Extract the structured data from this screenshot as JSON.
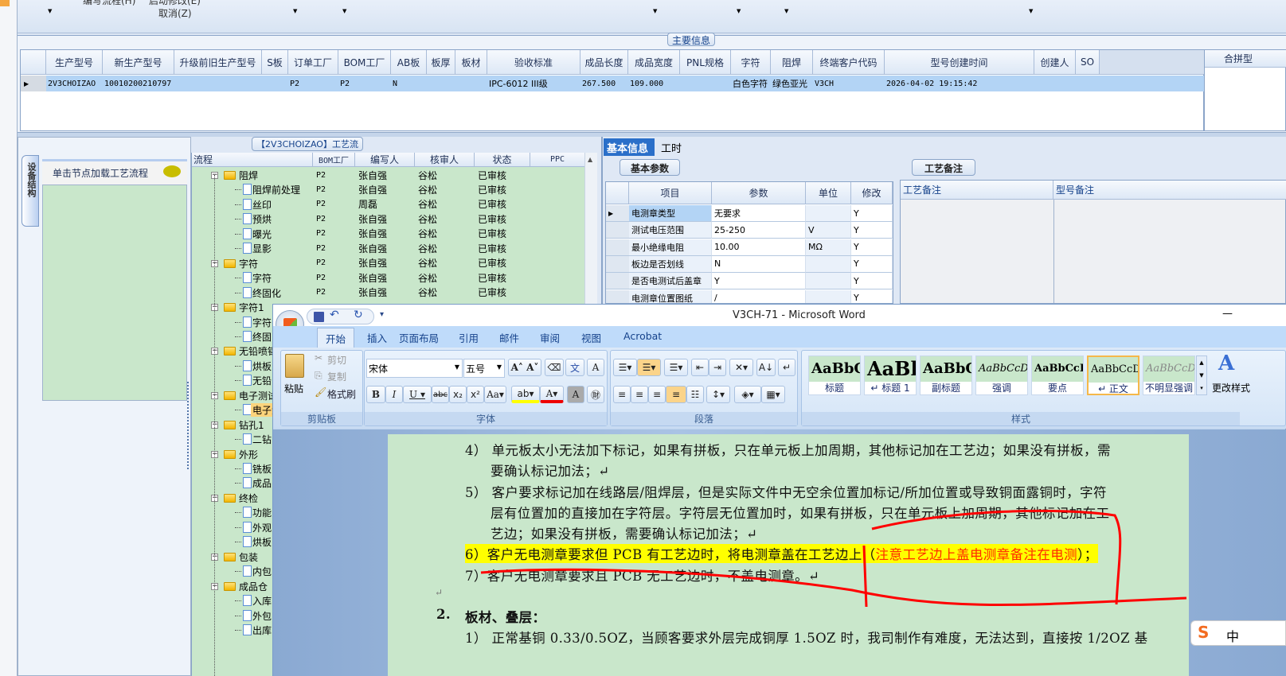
{
  "toolbar": {
    "edit_flow": "编写流程(H)",
    "start_modify": "启动修改(E)",
    "cancel": "取消(Z)"
  },
  "main_info": {
    "group_title": "主要信息",
    "right_header": "合拼型",
    "columns": [
      "生产型号",
      "新生产型号",
      "升级前旧生产型号",
      "S板",
      "订单工厂",
      "BOM工厂",
      "AB板",
      "板厚",
      "板材",
      "验收标准",
      "成品长度",
      "成品宽度",
      "PNL规格",
      "字符",
      "阻焊",
      "终端客户代码",
      "型号创建时间",
      "创建人",
      "SO"
    ],
    "row": [
      "2V3CHOIZAO",
      "10010200210797",
      "",
      "",
      "P2",
      "P2",
      "N",
      "",
      "",
      "IPC-6012 III级",
      "267.500",
      "109.000",
      "",
      "白色字符",
      "绿色亚光",
      "V3CH",
      "2026-04-02 19:15:42",
      "",
      ""
    ]
  },
  "left_panel": {
    "vertical_tab": "设备结构",
    "hint": "单击节点加载工艺流程"
  },
  "process": {
    "title": "【2V3CHOIZAO】工艺流程",
    "columns": [
      "流程",
      "BOM工厂",
      "编写人",
      "核审人",
      "状态",
      "PPC"
    ],
    "rows": [
      {
        "level": 0,
        "name": "阻焊",
        "cols": [
          "P2",
          "张自强",
          "谷松",
          "已审核",
          ""
        ]
      },
      {
        "level": 1,
        "name": "阻焊前处理",
        "cols": [
          "P2",
          "张自强",
          "谷松",
          "已审核",
          ""
        ]
      },
      {
        "level": 1,
        "name": "丝印",
        "cols": [
          "P2",
          "周磊",
          "谷松",
          "已审核",
          ""
        ]
      },
      {
        "level": 1,
        "name": "预烘",
        "cols": [
          "P2",
          "张自强",
          "谷松",
          "已审核",
          ""
        ]
      },
      {
        "level": 1,
        "name": "曝光",
        "cols": [
          "P2",
          "张自强",
          "谷松",
          "已审核",
          ""
        ]
      },
      {
        "level": 1,
        "name": "显影",
        "cols": [
          "P2",
          "张自强",
          "谷松",
          "已审核",
          ""
        ]
      },
      {
        "level": 0,
        "name": "字符",
        "cols": [
          "P2",
          "张自强",
          "谷松",
          "已审核",
          ""
        ]
      },
      {
        "level": 1,
        "name": "字符",
        "cols": [
          "P2",
          "张自强",
          "谷松",
          "已审核",
          ""
        ]
      },
      {
        "level": 1,
        "name": "终固化",
        "cols": [
          "P2",
          "张自强",
          "谷松",
          "已审核",
          ""
        ]
      },
      {
        "level": 0,
        "name": "字符1"
      },
      {
        "level": 1,
        "name": "字符"
      },
      {
        "level": 1,
        "name": "终固"
      },
      {
        "level": 0,
        "name": "无铅喷锡"
      },
      {
        "level": 1,
        "name": "烘板"
      },
      {
        "level": 1,
        "name": "无铅"
      },
      {
        "level": 0,
        "name": "电子测试"
      },
      {
        "level": 1,
        "name": "电子测",
        "selected": true
      },
      {
        "level": 0,
        "name": "钻孔1"
      },
      {
        "level": 1,
        "name": "二钻"
      },
      {
        "level": 0,
        "name": "外形"
      },
      {
        "level": 1,
        "name": "铣板"
      },
      {
        "level": 1,
        "name": "成品"
      },
      {
        "level": 0,
        "name": "终检"
      },
      {
        "level": 1,
        "name": "功能"
      },
      {
        "level": 1,
        "name": "外观"
      },
      {
        "level": 1,
        "name": "烘板"
      },
      {
        "level": 0,
        "name": "包装"
      },
      {
        "level": 1,
        "name": "内包"
      },
      {
        "level": 0,
        "name": "成品仓"
      },
      {
        "level": 1,
        "name": "入库"
      },
      {
        "level": 1,
        "name": "外包"
      },
      {
        "level": 1,
        "name": "出库"
      }
    ]
  },
  "info_tabs": {
    "tabs": [
      "基本信息",
      "工时"
    ],
    "sub_tab": "基本参数",
    "remark_tab": "工艺备注",
    "remark_cols": [
      "工艺备注",
      "型号备注"
    ]
  },
  "params": {
    "columns": [
      "项目",
      "参数",
      "单位",
      "修改"
    ],
    "rows": [
      [
        "电测章类型",
        "无要求",
        "",
        "Y"
      ],
      [
        "测试电压范围",
        "25-250",
        "V",
        "Y"
      ],
      [
        "最小绝缘电阻",
        "10.00",
        "MΩ",
        "Y"
      ],
      [
        "板边是否划线",
        "N",
        "",
        "Y"
      ],
      [
        "是否电测试后盖章",
        "Y",
        "",
        "Y"
      ],
      [
        "电测章位置图纸",
        "/",
        "",
        "Y"
      ]
    ]
  },
  "word": {
    "title": "V3CH-71 - Microsoft Word",
    "minimize": "—",
    "tabs": [
      "开始",
      "插入",
      "页面布局",
      "引用",
      "邮件",
      "审阅",
      "视图",
      "Acrobat"
    ],
    "clipboard": {
      "paste": "粘贴",
      "cut": "剪切",
      "copy": "复制",
      "format_painter": "格式刷",
      "group": "剪贴板"
    },
    "font": {
      "name": "宋体",
      "size": "五号",
      "group": "字体"
    },
    "paragraph_group": "段落",
    "styles": {
      "group": "样式",
      "change": "更改样式",
      "items": [
        {
          "preview": "AaBbC",
          "name": "标题"
        },
        {
          "preview": "AaBl",
          "name": "↵ 标题 1"
        },
        {
          "preview": "AaBbC",
          "name": "副标题"
        },
        {
          "preview": "AaBbCcDi",
          "name": "强调"
        },
        {
          "preview": "AaBbCcD",
          "name": "要点"
        },
        {
          "preview": "AaBbCcDi",
          "name": "↵ 正文"
        },
        {
          "preview": "AaBbCcDi",
          "name": "不明显强调"
        }
      ]
    },
    "doc": {
      "l1": "4）  单元板太小无法加下标记，如果有拼板，只在单元板上加周期，其他标记加在工艺边；如果没有拼板，需",
      "l2": "要确认标记加法；↵",
      "l3": "5）  客户要求标记加在线路层/阻焊层，但是实际文件中无空余位置加标记/所加位置或导致铜面露铜时，字符",
      "l4": "层有位置加的直接加在字符层。字符层无位置加时，如果有拼板，只在单元板上加周期，其他标记加在工",
      "l5": "艺边；如果没有拼板，需要确认标记加法；↵",
      "l6a": "6）客户无电测章要求但 PCB 有工艺边时，将电测章盖在工艺边上（",
      "l6b": "注意工艺边上盖电测章备注在电测",
      "l6c": "）；",
      "l7": "7）客户无电测章要求且 PCB 无工艺边时，不盖电测章。↵",
      "l8": "↵",
      "h2num": "2.",
      "h2": "板材、叠层：",
      "l9": "1）  正常基铜 0.33/0.5OZ，当顾客要求外层完成铜厚 1.5OZ 时，我司制作有难度，无法达到，直接按 1/2OZ 基"
    }
  },
  "ime": {
    "label": "中"
  }
}
